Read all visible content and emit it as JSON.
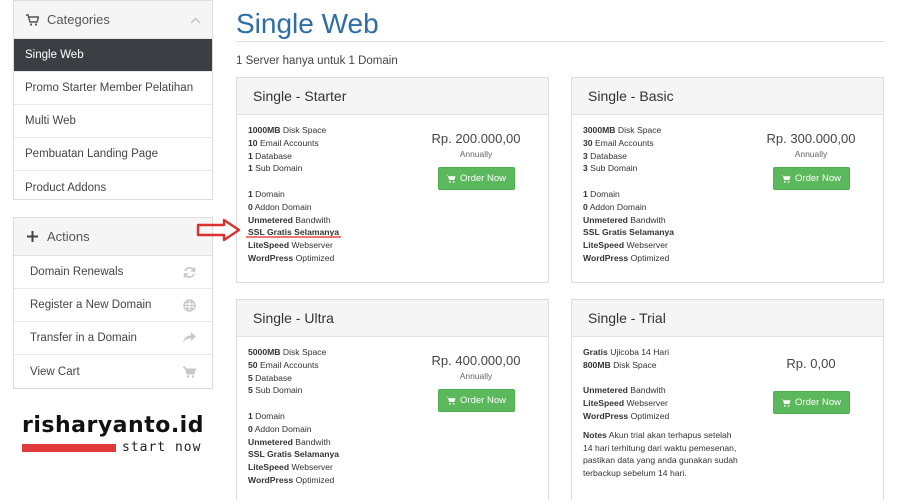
{
  "sidebar": {
    "categories": {
      "heading": "Categories",
      "items": [
        {
          "label": "Single Web",
          "active": true
        },
        {
          "label": "Promo Starter Member Pelatihan"
        },
        {
          "label": "Multi Web"
        },
        {
          "label": "Pembuatan Landing Page"
        },
        {
          "label": "Product Addons"
        }
      ]
    },
    "actions": {
      "heading": "Actions",
      "items": [
        {
          "label": "Domain Renewals",
          "icon": "refresh-icon"
        },
        {
          "label": "Register a New Domain",
          "icon": "globe-icon"
        },
        {
          "label": "Transfer in a Domain",
          "icon": "share-icon"
        },
        {
          "label": "View Cart",
          "icon": "cart-icon"
        }
      ]
    }
  },
  "brand": {
    "name": "risharyanto.id",
    "tagline": "start now",
    "accent": "#e03b3b"
  },
  "main": {
    "title": "Single Web",
    "subtitle": "1 Server hanya untuk 1 Domain",
    "order_label": "Order Now",
    "products": [
      {
        "name": "Single - Starter",
        "price": "Rp. 200.000,00",
        "cycle": "Annually",
        "features": [
          {
            "b": "1000MB",
            "t": " Disk Space"
          },
          {
            "b": "10",
            "t": " Email Accounts"
          },
          {
            "b": "1",
            "t": " Database"
          },
          {
            "b": "1",
            "t": " Sub Domain"
          },
          {
            "gap": true
          },
          {
            "b": "1",
            "t": " Domain"
          },
          {
            "b": "0",
            "t": " Addon Domain"
          },
          {
            "b": "Unmetered",
            "t": " Bandwith"
          },
          {
            "b": "SSL Gratis Selamanya",
            "t": ""
          },
          {
            "b": "LiteSpeed",
            "t": " Webserver"
          },
          {
            "b": "WordPress",
            "t": " Optimized"
          }
        ]
      },
      {
        "name": "Single - Basic",
        "price": "Rp. 300.000,00",
        "cycle": "Annually",
        "features": [
          {
            "b": "3000MB",
            "t": " Disk Space"
          },
          {
            "b": "30",
            "t": " Email Accounts"
          },
          {
            "b": "3",
            "t": " Database"
          },
          {
            "b": "3",
            "t": " Sub Domain"
          },
          {
            "gap": true
          },
          {
            "b": "1",
            "t": " Domain"
          },
          {
            "b": "0",
            "t": " Addon Domain"
          },
          {
            "b": "Unmetered",
            "t": " Bandwith"
          },
          {
            "b": "SSL Gratis Selamanya",
            "t": ""
          },
          {
            "b": "LiteSpeed",
            "t": " Webserver"
          },
          {
            "b": "WordPress",
            "t": " Optimized"
          }
        ]
      },
      {
        "name": "Single - Ultra",
        "price": "Rp. 400.000,00",
        "cycle": "Annually",
        "features": [
          {
            "b": "5000MB",
            "t": " Disk Space"
          },
          {
            "b": "50",
            "t": " Email Accounts"
          },
          {
            "b": "5",
            "t": " Database"
          },
          {
            "b": "5",
            "t": " Sub Domain"
          },
          {
            "gap": true
          },
          {
            "b": "1",
            "t": " Domain"
          },
          {
            "b": "0",
            "t": " Addon Domain"
          },
          {
            "b": "Unmetered",
            "t": " Bandwith"
          },
          {
            "b": "SSL Gratis Selamanya",
            "t": ""
          },
          {
            "b": "LiteSpeed",
            "t": " Webserver"
          },
          {
            "b": "WordPress",
            "t": " Optimized"
          }
        ]
      },
      {
        "name": "Single - Trial",
        "price": "Rp. 0,00",
        "cycle": "",
        "features": [
          {
            "b": "Gratis",
            "t": " Ujicoba 14 Hari"
          },
          {
            "b": "800MB",
            "t": " Disk Space"
          },
          {
            "gap": true
          },
          {
            "b": "Unmetered",
            "t": " Bandwith"
          },
          {
            "b": "LiteSpeed",
            "t": " Webserver"
          },
          {
            "b": "WordPress",
            "t": " Optimized"
          }
        ],
        "notes": {
          "label": "Notes",
          "lines": [
            " Akun trial akan terhapus setelah",
            "14 hari terhitung dari waktu pemesenan,",
            "pastikan data yang anda gunakan sudah",
            "terbackup sebelum 14 hari."
          ]
        }
      }
    ]
  },
  "colors": {
    "active_bg": "#3b3f44",
    "title": "#2d6ea6",
    "button": "#5cb85c",
    "annotation": "#d93030"
  }
}
